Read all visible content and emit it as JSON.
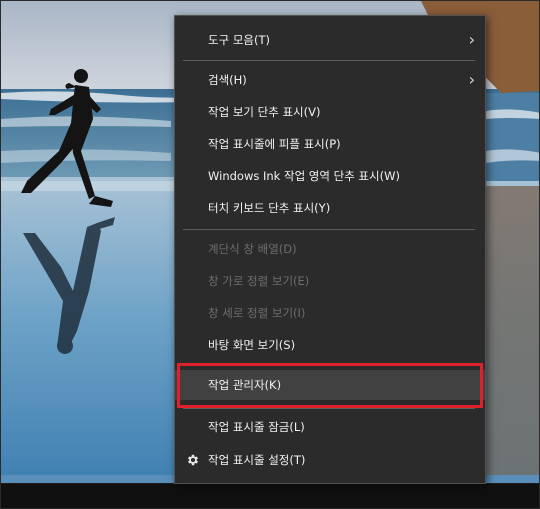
{
  "context_menu": {
    "items": [
      {
        "label": "도구 모음(T)",
        "submenu": true,
        "disabled": false
      },
      {
        "label": "검색(H)",
        "submenu": true,
        "disabled": false
      },
      {
        "label": "작업 보기 단추 표시(V)",
        "disabled": false
      },
      {
        "label": "작업 표시줄에 피플 표시(P)",
        "disabled": false
      },
      {
        "label": "Windows Ink 작업 영역 단추 표시(W)",
        "disabled": false
      },
      {
        "label": "터치 키보드 단추 표시(Y)",
        "disabled": false
      },
      {
        "label": "계단식 창 배열(D)",
        "disabled": true
      },
      {
        "label": "창 가로 정렬 보기(E)",
        "disabled": true
      },
      {
        "label": "창 세로 정렬 보기(I)",
        "disabled": true
      },
      {
        "label": "바탕 화면 보기(S)",
        "disabled": false
      },
      {
        "label": "작업 관리자(K)",
        "disabled": false,
        "highlighted": true
      },
      {
        "label": "작업 표시줄 잠금(L)",
        "disabled": false
      },
      {
        "label": "작업 표시줄 설정(T)",
        "disabled": false,
        "icon": "gear-icon"
      }
    ],
    "submenu_indicator": "›"
  },
  "colors": {
    "menu_background": "#2b2b2b",
    "menu_text": "#f2f2f2",
    "disabled_text": "#6d6d6d",
    "highlight_background": "#414141",
    "annotation_border": "#e0202a"
  }
}
